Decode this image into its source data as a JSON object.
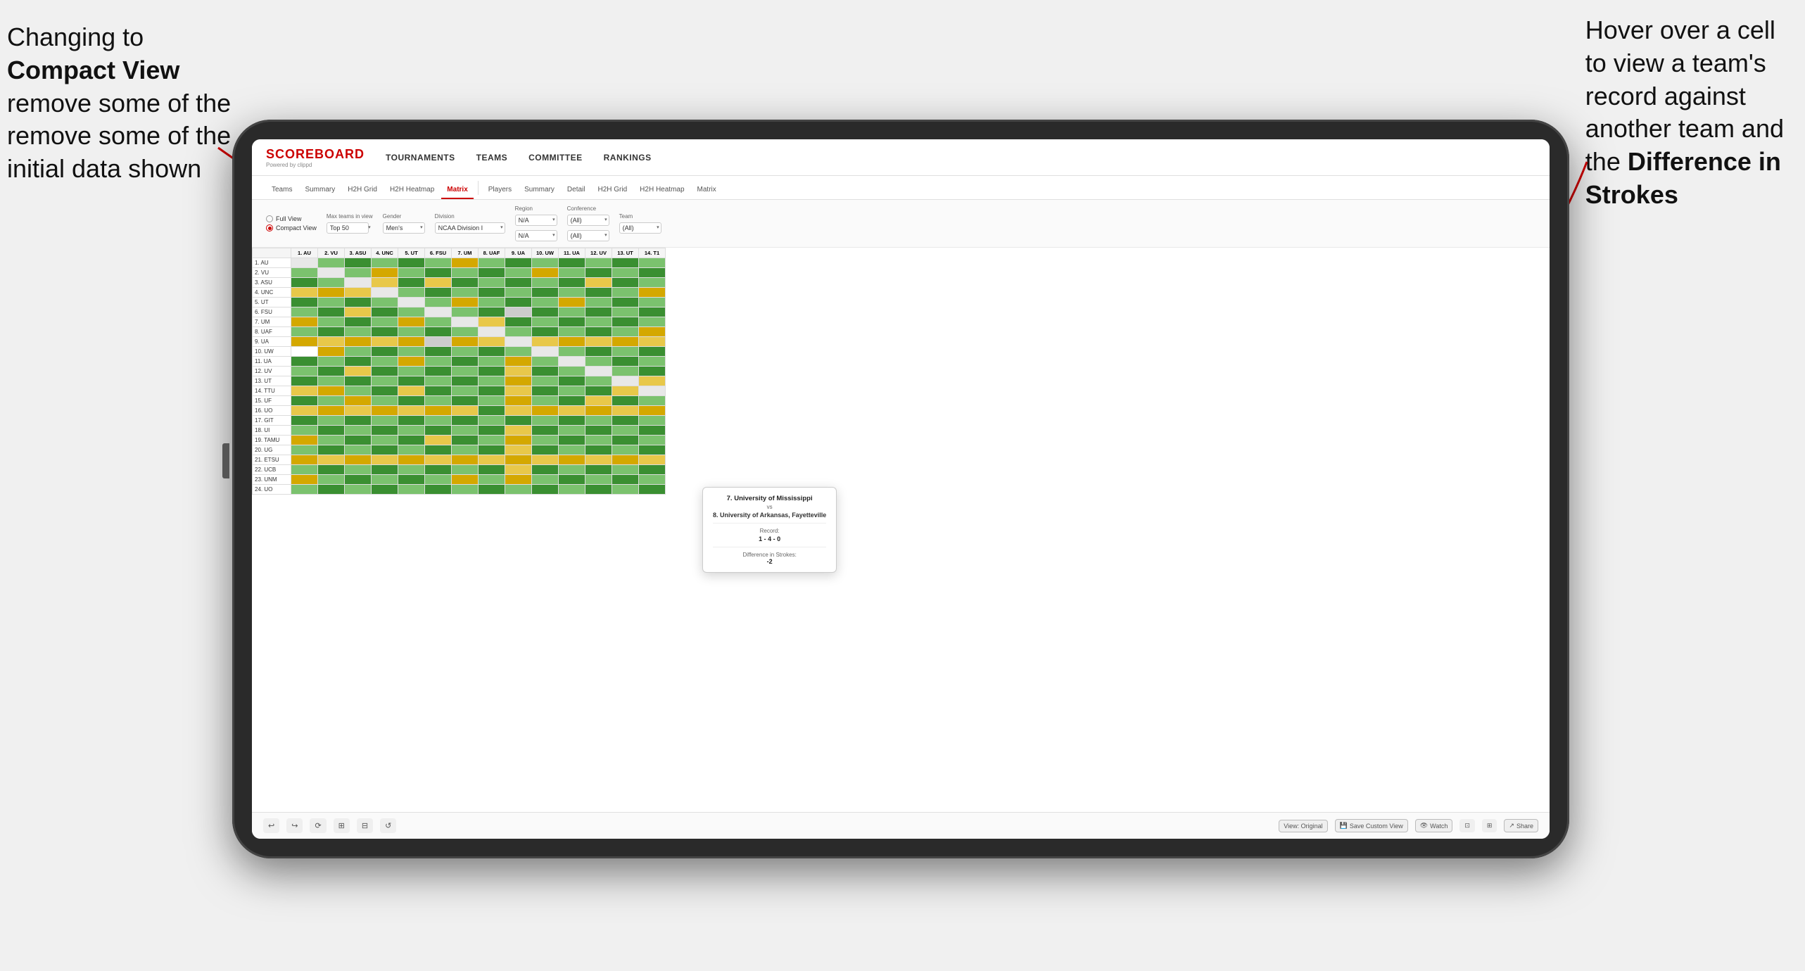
{
  "annotations": {
    "left_text_line1": "Changing to",
    "left_text_line2": "Compact View will",
    "left_text_line3": "remove some of the",
    "left_text_line4": "initial data shown",
    "right_text_line1": "Hover over a cell",
    "right_text_line2": "to view a team's",
    "right_text_line3": "record against",
    "right_text_line4": "another team and",
    "right_text_line5": "the ",
    "right_text_bold": "Difference in",
    "right_text_line6": "Strokes"
  },
  "header": {
    "logo": "SCOREBOARD",
    "logo_sub": "Powered by clippd",
    "nav": [
      "TOURNAMENTS",
      "TEAMS",
      "COMMITTEE",
      "RANKINGS"
    ]
  },
  "sub_tabs": {
    "group1": [
      "Teams",
      "Summary",
      "H2H Grid",
      "H2H Heatmap",
      "Matrix"
    ],
    "group2": [
      "Players",
      "Summary",
      "Detail",
      "H2H Grid",
      "H2H Heatmap",
      "Matrix"
    ],
    "active": "Matrix"
  },
  "filters": {
    "view_options": [
      "Full View",
      "Compact View"
    ],
    "selected_view": "Compact View",
    "max_teams_label": "Max teams in view",
    "max_teams_value": "Top 50",
    "gender_label": "Gender",
    "gender_value": "Men's",
    "division_label": "Division",
    "division_value": "NCAA Division I",
    "region_label": "Region",
    "region_value": "N/A",
    "region_value2": "N/A",
    "conference_label": "Conference",
    "conference_value": "(All)",
    "conference_value2": "(All)",
    "team_label": "Team",
    "team_value": "(All)"
  },
  "column_headers": [
    "1. AU",
    "2. VU",
    "3. ASU",
    "4. UNC",
    "5. UT",
    "6. FSU",
    "7. UM",
    "8. UAF",
    "9. UA",
    "10. UW",
    "11. UA",
    "12. UV",
    "13. UT",
    "14. T1"
  ],
  "rows": [
    {
      "label": "1. AU",
      "cells": [
        "",
        "g",
        "g",
        "g",
        "g",
        "g",
        "y",
        "g",
        "g",
        "g",
        "g",
        "g",
        "g",
        "g"
      ]
    },
    {
      "label": "2. VU",
      "cells": [
        "g",
        "",
        "g",
        "y",
        "g",
        "g",
        "g",
        "g",
        "g",
        "y",
        "g",
        "g",
        "g",
        "g"
      ]
    },
    {
      "label": "3. ASU",
      "cells": [
        "g",
        "g",
        "",
        "y",
        "g",
        "y",
        "g",
        "g",
        "g",
        "g",
        "g",
        "y",
        "g",
        "g"
      ]
    },
    {
      "label": "4. UNC",
      "cells": [
        "y",
        "y",
        "y",
        "",
        "g",
        "g",
        "g",
        "g",
        "g",
        "g",
        "g",
        "g",
        "g",
        "y"
      ]
    },
    {
      "label": "5. UT",
      "cells": [
        "g",
        "g",
        "g",
        "g",
        "",
        "g",
        "y",
        "g",
        "g",
        "g",
        "y",
        "g",
        "g",
        "g"
      ]
    },
    {
      "label": "6. FSU",
      "cells": [
        "g",
        "g",
        "y",
        "g",
        "g",
        "",
        "g",
        "g",
        "gr",
        "g",
        "g",
        "g",
        "g",
        "g"
      ]
    },
    {
      "label": "7. UM",
      "cells": [
        "y",
        "g",
        "g",
        "g",
        "y",
        "g",
        "",
        "y",
        "g",
        "g",
        "g",
        "g",
        "g",
        "g"
      ]
    },
    {
      "label": "8. UAF",
      "cells": [
        "g",
        "g",
        "g",
        "g",
        "g",
        "g",
        "g",
        "",
        "g",
        "g",
        "g",
        "g",
        "g",
        "y"
      ]
    },
    {
      "label": "9. UA",
      "cells": [
        "y",
        "y",
        "y",
        "y",
        "y",
        "gr",
        "y",
        "y",
        "",
        "y",
        "y",
        "y",
        "y",
        "y"
      ]
    },
    {
      "label": "10. UW",
      "cells": [
        "w",
        "y",
        "g",
        "g",
        "g",
        "g",
        "g",
        "g",
        "g",
        "",
        "g",
        "g",
        "g",
        "g"
      ]
    },
    {
      "label": "11. UA",
      "cells": [
        "g",
        "g",
        "g",
        "g",
        "y",
        "g",
        "g",
        "g",
        "y",
        "g",
        "",
        "g",
        "g",
        "g"
      ]
    },
    {
      "label": "12. UV",
      "cells": [
        "g",
        "g",
        "y",
        "g",
        "g",
        "g",
        "g",
        "g",
        "y",
        "g",
        "g",
        "",
        "g",
        "g"
      ]
    },
    {
      "label": "13. UT",
      "cells": [
        "g",
        "g",
        "g",
        "g",
        "g",
        "g",
        "g",
        "g",
        "y",
        "g",
        "g",
        "g",
        "",
        "y"
      ]
    },
    {
      "label": "14. TTU",
      "cells": [
        "y",
        "y",
        "g",
        "g",
        "y",
        "g",
        "g",
        "g",
        "y",
        "g",
        "g",
        "g",
        "y",
        ""
      ]
    },
    {
      "label": "15. UF",
      "cells": [
        "g",
        "g",
        "y",
        "g",
        "g",
        "g",
        "g",
        "g",
        "y",
        "g",
        "g",
        "y",
        "g",
        "g"
      ]
    },
    {
      "label": "16. UO",
      "cells": [
        "y",
        "y",
        "y",
        "y",
        "y",
        "y",
        "y",
        "g",
        "y",
        "y",
        "y",
        "y",
        "y",
        "y"
      ]
    },
    {
      "label": "17. GIT",
      "cells": [
        "g",
        "g",
        "g",
        "g",
        "g",
        "g",
        "g",
        "g",
        "g",
        "g",
        "g",
        "g",
        "g",
        "g"
      ]
    },
    {
      "label": "18. UI",
      "cells": [
        "g",
        "g",
        "g",
        "g",
        "g",
        "g",
        "g",
        "g",
        "y",
        "g",
        "g",
        "g",
        "g",
        "g"
      ]
    },
    {
      "label": "19. TAMU",
      "cells": [
        "y",
        "g",
        "g",
        "g",
        "g",
        "y",
        "g",
        "g",
        "y",
        "g",
        "g",
        "g",
        "g",
        "g"
      ]
    },
    {
      "label": "20. UG",
      "cells": [
        "g",
        "g",
        "g",
        "g",
        "g",
        "g",
        "g",
        "g",
        "y",
        "g",
        "g",
        "g",
        "g",
        "g"
      ]
    },
    {
      "label": "21. ETSU",
      "cells": [
        "y",
        "y",
        "y",
        "y",
        "y",
        "y",
        "y",
        "y",
        "y",
        "y",
        "y",
        "y",
        "y",
        "y"
      ]
    },
    {
      "label": "22. UCB",
      "cells": [
        "g",
        "g",
        "g",
        "g",
        "g",
        "g",
        "g",
        "g",
        "y",
        "g",
        "g",
        "g",
        "g",
        "g"
      ]
    },
    {
      "label": "23. UNM",
      "cells": [
        "y",
        "g",
        "g",
        "g",
        "g",
        "g",
        "y",
        "g",
        "y",
        "g",
        "g",
        "g",
        "g",
        "g"
      ]
    },
    {
      "label": "24. UO",
      "cells": [
        "g",
        "g",
        "g",
        "g",
        "g",
        "g",
        "g",
        "g",
        "g",
        "g",
        "g",
        "g",
        "g",
        "g"
      ]
    }
  ],
  "tooltip": {
    "team1": "7. University of Mississippi",
    "vs": "vs",
    "team2": "8. University of Arkansas, Fayetteville",
    "record_label": "Record:",
    "record": "1 - 4 - 0",
    "diff_label": "Difference in Strokes:",
    "diff": "-2"
  },
  "toolbar": {
    "undo": "↩",
    "redo": "↪",
    "tools": [
      "⟳",
      "⊞",
      "⊟",
      "↺"
    ],
    "view_original": "View: Original",
    "save_custom": "Save Custom View",
    "watch": "Watch",
    "share": "Share"
  },
  "colors": {
    "green": "#3a8f31",
    "yellow": "#d4a800",
    "gray": "#b0b0b0",
    "white": "#ffffff",
    "red_accent": "#cc0000"
  }
}
